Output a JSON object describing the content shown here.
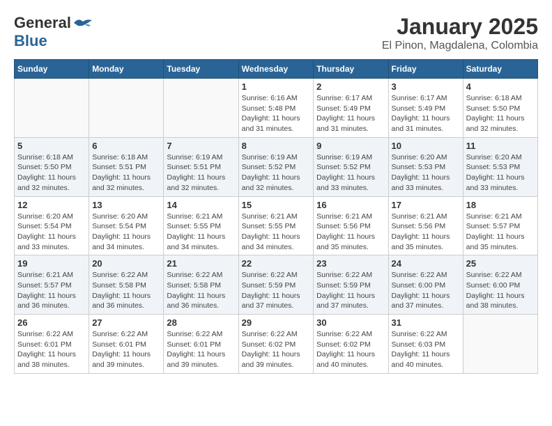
{
  "header": {
    "logo_general": "General",
    "logo_blue": "Blue",
    "month": "January 2025",
    "location": "El Pinon, Magdalena, Colombia"
  },
  "days_of_week": [
    "Sunday",
    "Monday",
    "Tuesday",
    "Wednesday",
    "Thursday",
    "Friday",
    "Saturday"
  ],
  "weeks": [
    [
      {
        "day": "",
        "info": ""
      },
      {
        "day": "",
        "info": ""
      },
      {
        "day": "",
        "info": ""
      },
      {
        "day": "1",
        "info": "Sunrise: 6:16 AM\nSunset: 5:48 PM\nDaylight: 11 hours and 31 minutes."
      },
      {
        "day": "2",
        "info": "Sunrise: 6:17 AM\nSunset: 5:49 PM\nDaylight: 11 hours and 31 minutes."
      },
      {
        "day": "3",
        "info": "Sunrise: 6:17 AM\nSunset: 5:49 PM\nDaylight: 11 hours and 31 minutes."
      },
      {
        "day": "4",
        "info": "Sunrise: 6:18 AM\nSunset: 5:50 PM\nDaylight: 11 hours and 32 minutes."
      }
    ],
    [
      {
        "day": "5",
        "info": "Sunrise: 6:18 AM\nSunset: 5:50 PM\nDaylight: 11 hours and 32 minutes."
      },
      {
        "day": "6",
        "info": "Sunrise: 6:18 AM\nSunset: 5:51 PM\nDaylight: 11 hours and 32 minutes."
      },
      {
        "day": "7",
        "info": "Sunrise: 6:19 AM\nSunset: 5:51 PM\nDaylight: 11 hours and 32 minutes."
      },
      {
        "day": "8",
        "info": "Sunrise: 6:19 AM\nSunset: 5:52 PM\nDaylight: 11 hours and 32 minutes."
      },
      {
        "day": "9",
        "info": "Sunrise: 6:19 AM\nSunset: 5:52 PM\nDaylight: 11 hours and 33 minutes."
      },
      {
        "day": "10",
        "info": "Sunrise: 6:20 AM\nSunset: 5:53 PM\nDaylight: 11 hours and 33 minutes."
      },
      {
        "day": "11",
        "info": "Sunrise: 6:20 AM\nSunset: 5:53 PM\nDaylight: 11 hours and 33 minutes."
      }
    ],
    [
      {
        "day": "12",
        "info": "Sunrise: 6:20 AM\nSunset: 5:54 PM\nDaylight: 11 hours and 33 minutes."
      },
      {
        "day": "13",
        "info": "Sunrise: 6:20 AM\nSunset: 5:54 PM\nDaylight: 11 hours and 34 minutes."
      },
      {
        "day": "14",
        "info": "Sunrise: 6:21 AM\nSunset: 5:55 PM\nDaylight: 11 hours and 34 minutes."
      },
      {
        "day": "15",
        "info": "Sunrise: 6:21 AM\nSunset: 5:55 PM\nDaylight: 11 hours and 34 minutes."
      },
      {
        "day": "16",
        "info": "Sunrise: 6:21 AM\nSunset: 5:56 PM\nDaylight: 11 hours and 35 minutes."
      },
      {
        "day": "17",
        "info": "Sunrise: 6:21 AM\nSunset: 5:56 PM\nDaylight: 11 hours and 35 minutes."
      },
      {
        "day": "18",
        "info": "Sunrise: 6:21 AM\nSunset: 5:57 PM\nDaylight: 11 hours and 35 minutes."
      }
    ],
    [
      {
        "day": "19",
        "info": "Sunrise: 6:21 AM\nSunset: 5:57 PM\nDaylight: 11 hours and 36 minutes."
      },
      {
        "day": "20",
        "info": "Sunrise: 6:22 AM\nSunset: 5:58 PM\nDaylight: 11 hours and 36 minutes."
      },
      {
        "day": "21",
        "info": "Sunrise: 6:22 AM\nSunset: 5:58 PM\nDaylight: 11 hours and 36 minutes."
      },
      {
        "day": "22",
        "info": "Sunrise: 6:22 AM\nSunset: 5:59 PM\nDaylight: 11 hours and 37 minutes."
      },
      {
        "day": "23",
        "info": "Sunrise: 6:22 AM\nSunset: 5:59 PM\nDaylight: 11 hours and 37 minutes."
      },
      {
        "day": "24",
        "info": "Sunrise: 6:22 AM\nSunset: 6:00 PM\nDaylight: 11 hours and 37 minutes."
      },
      {
        "day": "25",
        "info": "Sunrise: 6:22 AM\nSunset: 6:00 PM\nDaylight: 11 hours and 38 minutes."
      }
    ],
    [
      {
        "day": "26",
        "info": "Sunrise: 6:22 AM\nSunset: 6:01 PM\nDaylight: 11 hours and 38 minutes."
      },
      {
        "day": "27",
        "info": "Sunrise: 6:22 AM\nSunset: 6:01 PM\nDaylight: 11 hours and 39 minutes."
      },
      {
        "day": "28",
        "info": "Sunrise: 6:22 AM\nSunset: 6:01 PM\nDaylight: 11 hours and 39 minutes."
      },
      {
        "day": "29",
        "info": "Sunrise: 6:22 AM\nSunset: 6:02 PM\nDaylight: 11 hours and 39 minutes."
      },
      {
        "day": "30",
        "info": "Sunrise: 6:22 AM\nSunset: 6:02 PM\nDaylight: 11 hours and 40 minutes."
      },
      {
        "day": "31",
        "info": "Sunrise: 6:22 AM\nSunset: 6:03 PM\nDaylight: 11 hours and 40 minutes."
      },
      {
        "day": "",
        "info": ""
      }
    ]
  ]
}
